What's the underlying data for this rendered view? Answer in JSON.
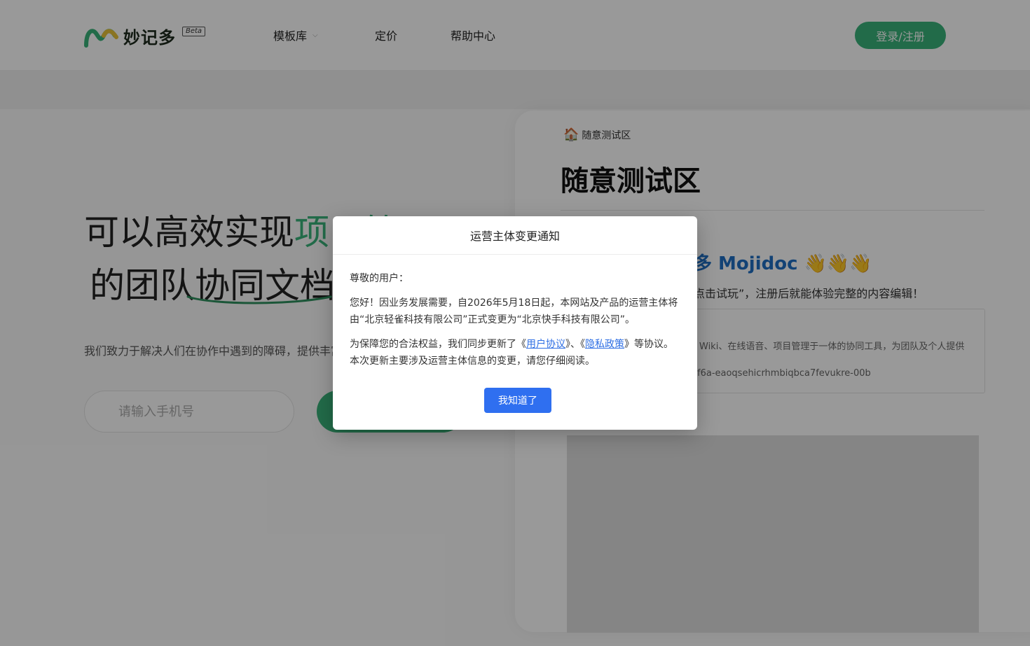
{
  "header": {
    "logo_text": "妙记多",
    "beta_badge": "Beta",
    "nav": {
      "templates": "模板库",
      "pricing": "定价",
      "help": "帮助中心"
    },
    "login_label": "登录/注册"
  },
  "hero": {
    "line1_prefix": "可以高效实现",
    "line1_highlight": "项目管理",
    "line2": "的团队协同文档",
    "description": "我们致力于解决人们在协作中遇到的障碍，提供丰富",
    "phone_placeholder": "请输入手机号"
  },
  "doc_preview": {
    "breadcrumb": "随意测试区",
    "title": "随意测试区",
    "heading": "多 Mojidoc",
    "heading_emoji": "👋👋👋",
    "subtitle": "点击试玩”，注册后就能体验完整的内容编辑！",
    "box_line1": "Wiki、在线语音、项目管理于一体的协同工具，为团队及个人提供",
    "box_line2": "f6a-eaoqsehicrhmbiqbca7fevukre-00b"
  },
  "modal": {
    "title": "运营主体变更通知",
    "greeting": "尊敬的用户：",
    "para1": "您好！因业务发展需要，自2026年5月18日起，本网站及产品的运营主体将由“北京轻雀科技有限公司”正式变更为“北京快手科技有限公司”。",
    "para2_prefix": "为保障您的合法权益，我们同步更新了《",
    "link_user_agreement": "用户协议",
    "para2_mid": "》、《",
    "link_privacy": "隐私政策",
    "para2_suffix": "》等协议。本次更新主要涉及运营主体信息的变更，请您仔细阅读。",
    "ok_label": "我知道了"
  },
  "colors": {
    "brand_green": "#3ab37a",
    "link_blue": "#2f6fe4",
    "button_blue": "#2f6ff0",
    "heading_blue": "#1e6fc4"
  }
}
